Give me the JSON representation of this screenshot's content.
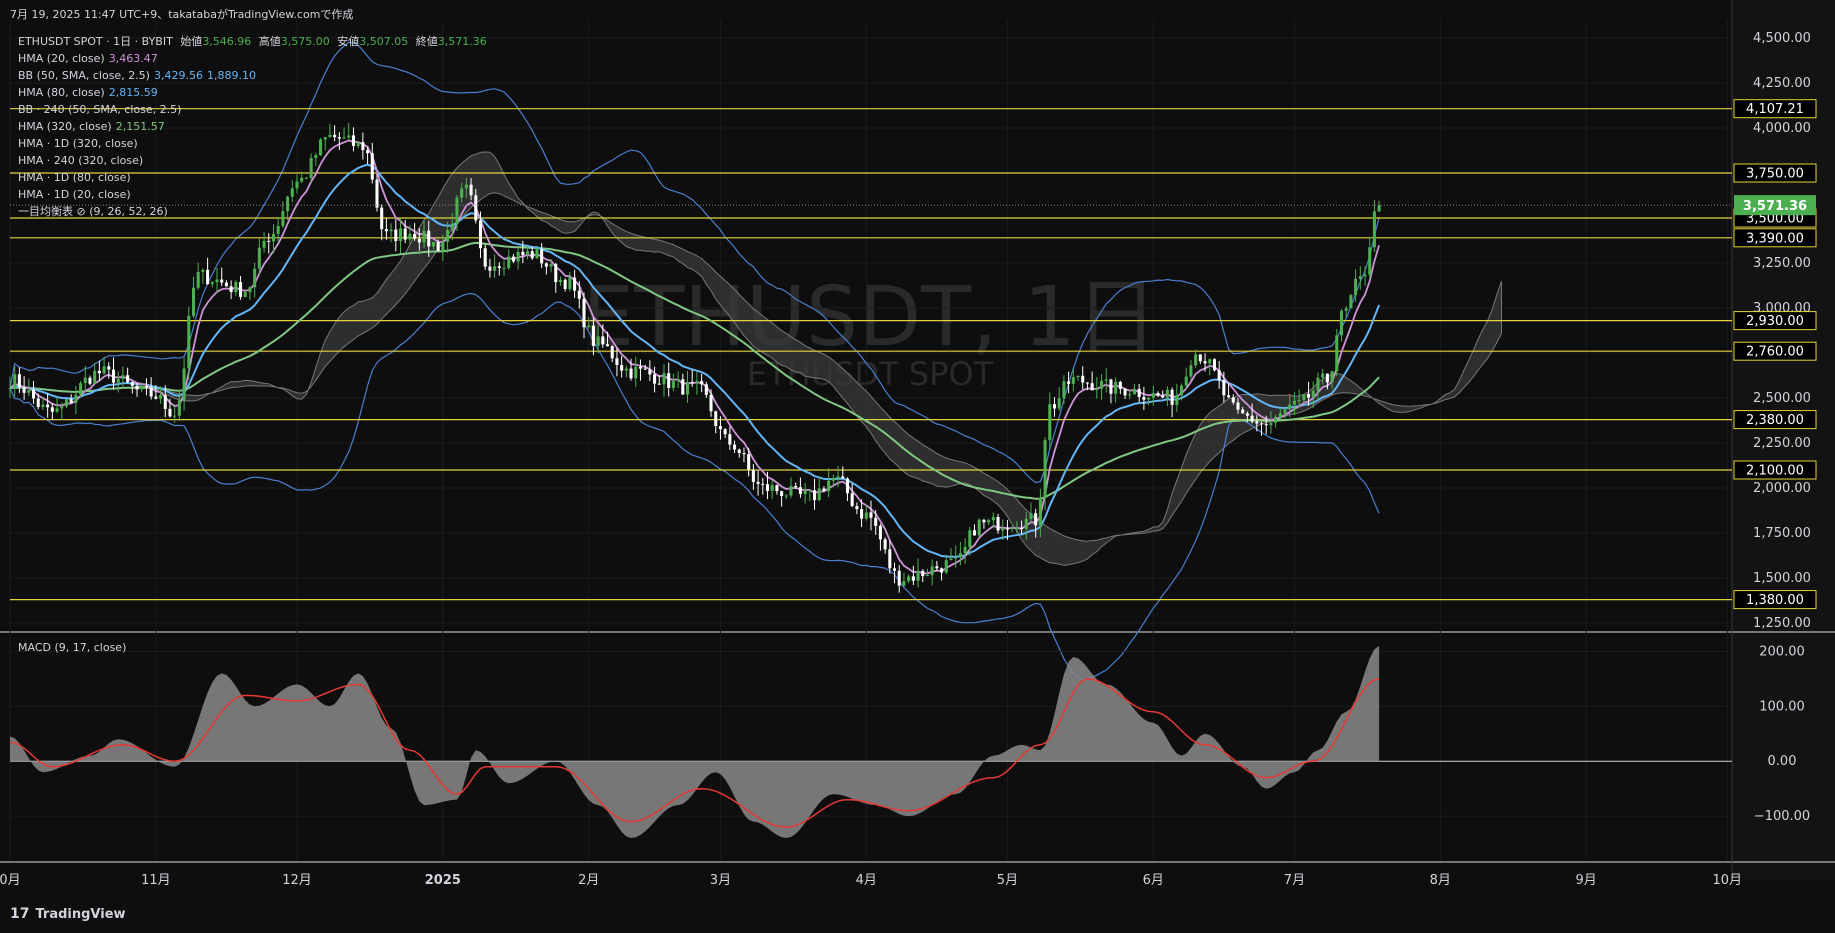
{
  "header": {
    "caption": "7月 19, 2025 11:47 UTC+9、takatabaがTradingView.comで作成"
  },
  "legend": {
    "symbol": "ETHUSDT SPOT · 1日 · BYBIT",
    "open_label": "始値",
    "open": "3,546.96",
    "high_label": "高値",
    "high": "3,575.00",
    "low_label": "安値",
    "low": "3,507.05",
    "close_label": "終値",
    "close": "3,571.36",
    "indicators": [
      {
        "name": "HMA (20, close)",
        "values": [
          "3,463.47"
        ],
        "colors": [
          "#ce93d8"
        ]
      },
      {
        "name": "BB (50, SMA, close, 2.5)",
        "values": [
          "3,429.56",
          "1,889.10"
        ],
        "colors": [
          "#64b5f6",
          "#64b5f6"
        ]
      },
      {
        "name": "HMA (80, close)",
        "values": [
          "2,815.59"
        ],
        "colors": [
          "#64b5f6"
        ]
      },
      {
        "name": "BB · 240 (50, SMA, close, 2.5)",
        "values": [],
        "colors": []
      },
      {
        "name": "HMA (320, close)",
        "values": [
          "2,151.57"
        ],
        "colors": [
          "#81c784"
        ]
      },
      {
        "name": "HMA · 1D (320, close)",
        "values": [],
        "colors": []
      },
      {
        "name": "HMA · 240 (320, close)",
        "values": [],
        "colors": []
      },
      {
        "name": "HMA · 1D (80, close)",
        "values": [],
        "colors": []
      },
      {
        "name": "HMA · 1D (20, close)",
        "values": [],
        "colors": []
      },
      {
        "name": "一目均衡表 ⊘ (9, 26, 52, 26)",
        "values": [],
        "colors": []
      }
    ]
  },
  "watermark": {
    "big": "ETHUSDT, 1日",
    "small": "ETHUSDT SPOT"
  },
  "macd_label": "MACD (9, 17, close)",
  "footer": {
    "brand": "TradingView",
    "logo": "17"
  },
  "colors": {
    "bg": "#0e0e0e",
    "grid": "#1c1c1c",
    "up": "#4caf50",
    "down": "#ffffff",
    "hma20": "#ce93d8",
    "hma80": "#64b5f6",
    "hma320": "#81c784",
    "bb": "#4a7fd0",
    "hline": "#e6d23c",
    "macd_hist": "#8a8a8a",
    "macd_signal": "#e53935",
    "label_bg": "#000000",
    "last_price_bg": "#4caf50"
  },
  "chart_data": {
    "type": "candlestick",
    "title": "ETHUSDT SPOT · 1日 · BYBIT",
    "price_axis": {
      "ticks": [
        4500,
        4250,
        4000,
        3750,
        3500,
        3250,
        3000,
        2750,
        2500,
        2250,
        2000,
        1750,
        1500,
        1250
      ],
      "tick_labels": [
        "4,500.00",
        "4,250.00",
        "4,000.00",
        "3,750.00",
        "3,500.00",
        "3,250.00",
        "3,000.00",
        "2,750.00",
        "2,500.00",
        "2,250.00",
        "2,000.00",
        "1,750.00",
        "1,500.00",
        "1,250.00"
      ],
      "ylim": [
        1200,
        4600
      ]
    },
    "time_axis": {
      "labels": [
        "0月",
        "11月",
        "12月",
        "2025",
        "2月",
        "3月",
        "4月",
        "5月",
        "6月",
        "7月",
        "8月",
        "9月",
        "10月"
      ],
      "dates": [
        "2024-10-01",
        "2024-11-01",
        "2024-12-01",
        "2025-01-01",
        "2025-02-01",
        "2025-03-01",
        "2025-04-01",
        "2025-05-01",
        "2025-06-01",
        "2025-07-01",
        "2025-08-01",
        "2025-09-01",
        "2025-10-01"
      ],
      "xlim": [
        "2024-10-01",
        "2025-10-02"
      ]
    },
    "horizontal_levels": [
      {
        "value": 4107.21,
        "label": "4,107.21"
      },
      {
        "value": 3750,
        "label": "3,750.00"
      },
      {
        "value": 3500,
        "label": "3,500.00"
      },
      {
        "value": 3390,
        "label": "3,390.00"
      },
      {
        "value": 2930,
        "label": "2,930.00"
      },
      {
        "value": 2760,
        "label": "2,760.00"
      },
      {
        "value": 2380,
        "label": "2,380.00"
      },
      {
        "value": 2100,
        "label": "2,100.00"
      },
      {
        "value": 1380,
        "label": "1,380.00"
      }
    ],
    "last_price": {
      "value": 3571.36,
      "label": "3,571.36"
    },
    "close_series_anchors": [
      [
        "2024-10-01",
        2600
      ],
      [
        "2024-10-10",
        2420
      ],
      [
        "2024-10-20",
        2640
      ],
      [
        "2024-10-31",
        2520
      ],
      [
        "2024-11-05",
        2420
      ],
      [
        "2024-11-10",
        3180
      ],
      [
        "2024-11-20",
        3100
      ],
      [
        "2024-11-25",
        3400
      ],
      [
        "2024-12-01",
        3700
      ],
      [
        "2024-12-08",
        3950
      ],
      [
        "2024-12-15",
        3900
      ],
      [
        "2024-12-20",
        3400
      ],
      [
        "2024-12-25",
        3420
      ],
      [
        "2024-12-31",
        3350
      ],
      [
        "2025-01-06",
        3650
      ],
      [
        "2025-01-10",
        3250
      ],
      [
        "2025-01-20",
        3300
      ],
      [
        "2025-01-27",
        3150
      ],
      [
        "2025-02-03",
        2800
      ],
      [
        "2025-02-10",
        2650
      ],
      [
        "2025-02-24",
        2550
      ],
      [
        "2025-03-03",
        2250
      ],
      [
        "2025-03-10",
        2000
      ],
      [
        "2025-03-20",
        1950
      ],
      [
        "2025-03-25",
        2050
      ],
      [
        "2025-04-01",
        1850
      ],
      [
        "2025-04-08",
        1500
      ],
      [
        "2025-04-20",
        1580
      ],
      [
        "2025-04-25",
        1800
      ],
      [
        "2025-05-07",
        1820
      ],
      [
        "2025-05-10",
        2450
      ],
      [
        "2025-05-15",
        2600
      ],
      [
        "2025-05-25",
        2550
      ],
      [
        "2025-06-05",
        2500
      ],
      [
        "2025-06-10",
        2750
      ],
      [
        "2025-06-20",
        2400
      ],
      [
        "2025-06-25",
        2350
      ],
      [
        "2025-07-01",
        2450
      ],
      [
        "2025-07-08",
        2600
      ],
      [
        "2025-07-11",
        2950
      ],
      [
        "2025-07-15",
        3150
      ],
      [
        "2025-07-19",
        3571.36
      ]
    ],
    "macd": {
      "title": "MACD (9, 17, close)",
      "ticks": [
        200,
        100,
        0,
        -100
      ],
      "tick_labels": [
        "200.00",
        "100.00",
        "0.00",
        "−100.00"
      ],
      "ylim": [
        -180,
        230
      ],
      "histogram_anchors": [
        [
          "2024-10-01",
          45
        ],
        [
          "2024-10-08",
          -20
        ],
        [
          "2024-10-18",
          10
        ],
        [
          "2024-10-24",
          40
        ],
        [
          "2024-11-05",
          -10
        ],
        [
          "2024-11-15",
          160
        ],
        [
          "2024-11-22",
          100
        ],
        [
          "2024-12-01",
          140
        ],
        [
          "2024-12-08",
          100
        ],
        [
          "2024-12-14",
          160
        ],
        [
          "2024-12-21",
          60
        ],
        [
          "2024-12-28",
          -80
        ],
        [
          "2025-01-04",
          -70
        ],
        [
          "2025-01-08",
          20
        ],
        [
          "2025-01-15",
          -40
        ],
        [
          "2025-01-25",
          0
        ],
        [
          "2025-02-03",
          -80
        ],
        [
          "2025-02-10",
          -140
        ],
        [
          "2025-02-20",
          -80
        ],
        [
          "2025-02-28",
          -20
        ],
        [
          "2025-03-08",
          -110
        ],
        [
          "2025-03-15",
          -140
        ],
        [
          "2025-03-25",
          -60
        ],
        [
          "2025-04-03",
          -80
        ],
        [
          "2025-04-10",
          -100
        ],
        [
          "2025-04-20",
          -60
        ],
        [
          "2025-04-28",
          10
        ],
        [
          "2025-05-04",
          30
        ],
        [
          "2025-05-08",
          20
        ],
        [
          "2025-05-15",
          190
        ],
        [
          "2025-05-22",
          140
        ],
        [
          "2025-06-01",
          70
        ],
        [
          "2025-06-07",
          10
        ],
        [
          "2025-06-12",
          50
        ],
        [
          "2025-06-20",
          -10
        ],
        [
          "2025-06-25",
          -50
        ],
        [
          "2025-07-01",
          -20
        ],
        [
          "2025-07-06",
          20
        ],
        [
          "2025-07-12",
          90
        ],
        [
          "2025-07-19",
          210
        ]
      ],
      "signal_anchors": [
        [
          "2024-10-01",
          35
        ],
        [
          "2024-10-10",
          -10
        ],
        [
          "2024-10-25",
          30
        ],
        [
          "2024-11-05",
          0
        ],
        [
          "2024-11-20",
          120
        ],
        [
          "2024-12-01",
          110
        ],
        [
          "2024-12-14",
          140
        ],
        [
          "2024-12-25",
          20
        ],
        [
          "2025-01-04",
          -60
        ],
        [
          "2025-01-10",
          -10
        ],
        [
          "2025-01-25",
          -10
        ],
        [
          "2025-02-10",
          -110
        ],
        [
          "2025-02-25",
          -50
        ],
        [
          "2025-03-15",
          -120
        ],
        [
          "2025-03-28",
          -70
        ],
        [
          "2025-04-10",
          -90
        ],
        [
          "2025-04-28",
          -30
        ],
        [
          "2025-05-08",
          30
        ],
        [
          "2025-05-18",
          150
        ],
        [
          "2025-06-01",
          90
        ],
        [
          "2025-06-12",
          30
        ],
        [
          "2025-06-25",
          -30
        ],
        [
          "2025-07-05",
          0
        ],
        [
          "2025-07-19",
          150
        ]
      ]
    }
  }
}
